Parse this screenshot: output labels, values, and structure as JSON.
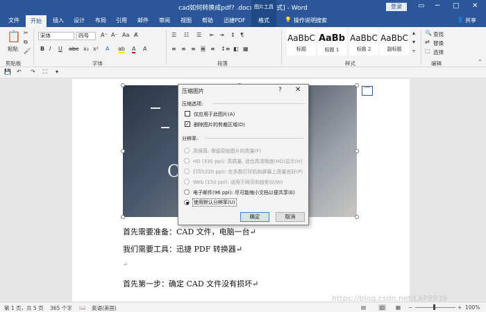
{
  "window": {
    "title": "cad如何转换成pdf? .docx [兼容模式] - Word",
    "login": "登录",
    "share": "共享"
  },
  "picture_tools": "图片工具",
  "tabs": [
    "文件",
    "开始",
    "插入",
    "设计",
    "布局",
    "引用",
    "邮件",
    "审阅",
    "视图",
    "帮助",
    "迅捷PDF",
    "格式"
  ],
  "tell_me": "操作说明搜索",
  "ribbon": {
    "clipboard": {
      "paste": "粘贴",
      "label": "剪贴板"
    },
    "font": {
      "name": "宋体",
      "size": "四号",
      "label": "字体"
    },
    "paragraph": {
      "label": "段落"
    },
    "styles": {
      "items": [
        {
          "preview": "AaBbC",
          "name": "标题"
        },
        {
          "preview": "AaBb",
          "name": "标题 1"
        },
        {
          "preview": "AaBbC",
          "name": "标题 2"
        },
        {
          "preview": "AaBbC",
          "name": "副标题"
        }
      ],
      "label": "样式"
    },
    "editing": {
      "find": "查找",
      "replace": "替换",
      "select": "选择",
      "label": "编辑"
    }
  },
  "dialog": {
    "title": "压缩图片",
    "help": "?",
    "section_compress": "压缩选项:",
    "opt_only_this": "仅应用于此图片(A)",
    "opt_delete_crop": "删除图片的剪裁区域(D)",
    "section_resolution": "分辨率:",
    "res": [
      {
        "label": "高保真: 保留原始图片的质量(F)",
        "state": "disabled"
      },
      {
        "label": "HD (330 ppi): 高质量, 适合高清晰度(HD)显示(H)",
        "state": "disabled"
      },
      {
        "label": "打印(220 ppi): 在多数打印机和屏幕上质量良好(P)",
        "state": "disabled"
      },
      {
        "label": "Web (150 ppi): 适用于网页和投影仪(W)",
        "state": "disabled"
      },
      {
        "label": "电子邮件(96 ppi): 尽可能缩小文档以便共享(E)",
        "state": "off"
      },
      {
        "label": "使用默认分辨率(U)",
        "state": "on"
      }
    ],
    "ok": "确定",
    "cancel": "取消"
  },
  "document": {
    "lines": [
      "首先需要准备：CAD 文件，电脑一台↵",
      "我们需要工具：迅捷 PDF 转换器↵",
      "↵",
      "首先第一步：确定 CAD 文件没有损坏↵"
    ]
  },
  "status": {
    "page": "第 1 页，共 5 页",
    "words": "365 个字",
    "lang": "英语(美国)",
    "zoom": "100%"
  },
  "watermark": "https://blog.csdn.net/LXP8939"
}
